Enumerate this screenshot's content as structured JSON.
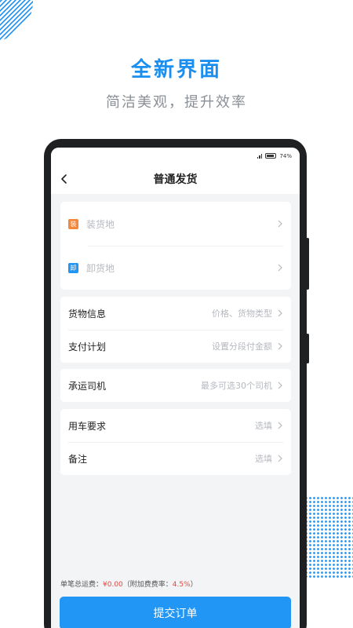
{
  "hero": {
    "title": "全新界面",
    "subtitle": "简洁美观，提升效率"
  },
  "status_bar": {
    "battery": "74%"
  },
  "nav": {
    "title": "普通发货",
    "back_icon": "chevron-left-icon"
  },
  "locations": [
    {
      "badge": "装",
      "badge_color": "#f5873b",
      "label": "装货地"
    },
    {
      "badge": "卸",
      "badge_color": "#2196f5",
      "label": "卸货地"
    }
  ],
  "cargo_card": [
    {
      "label": "货物信息",
      "value": "价格、货物类型"
    },
    {
      "label": "支付计划",
      "value": "设置分段付金额"
    }
  ],
  "driver_card": [
    {
      "label": "承运司机",
      "value": "最多可选30个司机"
    }
  ],
  "extra_card": [
    {
      "label": "用车要求",
      "value": "选填"
    },
    {
      "label": "备注",
      "value": "选填"
    }
  ],
  "footer": {
    "fee_label": "单笔总运费：",
    "fee_amount": "¥0.00",
    "rate_label": "（附加费费率：",
    "rate_value": "4.5%",
    "rate_close": "）",
    "submit_label": "提交订单"
  },
  "colors": {
    "accent": "#1a8ff0",
    "button": "#2196f5",
    "load_badge": "#f5873b",
    "unload_badge": "#2196f5",
    "fee_highlight": "#e8463c"
  }
}
